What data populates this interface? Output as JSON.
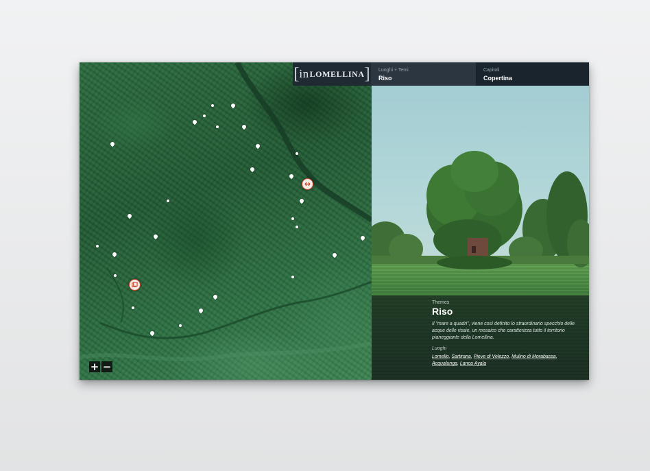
{
  "brand": {
    "logo_prefix": "in",
    "logo_name": "LOMELLINA",
    "bracket_open": "[",
    "bracket_close": "]"
  },
  "header": {
    "places_label": "Luoghi + Temi",
    "places_value": "Riso",
    "chapters_label": "Capitoli",
    "chapters_value": "Copertina"
  },
  "map": {
    "zoom_in_label": "+",
    "zoom_out_label": "−",
    "pin_icon": "map-pin-icon",
    "marker_active_icon": "double-arrow-icon",
    "marker_photo_icon": "photo-icon",
    "marker_color": "#c9452f"
  },
  "theme": {
    "kicker": "Themes",
    "title": "Riso",
    "description": "Il \"mare a quadri\", viene così definito lo straordinario specchio delle acque delle risaie, un mosaico che caratterizza tutto il territorio pianeggiante della Lomellina.",
    "places_label": "Luoghi",
    "places": [
      "Lomello",
      "Sartirana",
      "Pieve di Velezzo",
      "Mulino di Morabassa",
      "Acqualunga",
      "Lanca Ayala"
    ]
  },
  "colors": {
    "header_bg": "#1f2a33",
    "map_green": "#215a33",
    "overlay": "#17261e"
  }
}
